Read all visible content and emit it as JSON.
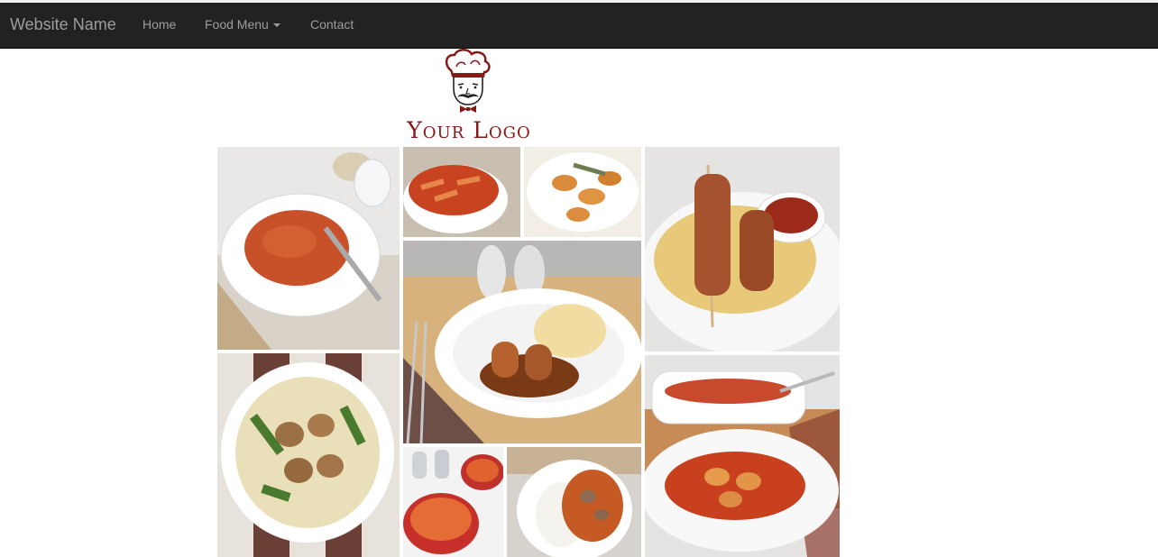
{
  "navbar": {
    "brand": "Website Name",
    "links": [
      {
        "label": "Home"
      },
      {
        "label": "Food Menu",
        "dropdown": true
      },
      {
        "label": "Contact"
      }
    ]
  },
  "logo": {
    "text": "Your Logo",
    "icon": "chef-icon"
  },
  "colors": {
    "navbar_bg": "#222222",
    "nav_text": "#9d9d9d",
    "logo_red": "#861818"
  },
  "gallery": [
    {
      "name": "tomato-risotto-bowl"
    },
    {
      "name": "penne-arrabbiata"
    },
    {
      "name": "pumpkin-gnocchi-sage"
    },
    {
      "name": "kebab-skewers-couscous"
    },
    {
      "name": "sausages-mash-onion-gravy"
    },
    {
      "name": "meatball-pasta-shells"
    },
    {
      "name": "spaghetti-bowl"
    },
    {
      "name": "chicken-curry-rice"
    },
    {
      "name": "baked-gnocchi-tomato"
    }
  ]
}
